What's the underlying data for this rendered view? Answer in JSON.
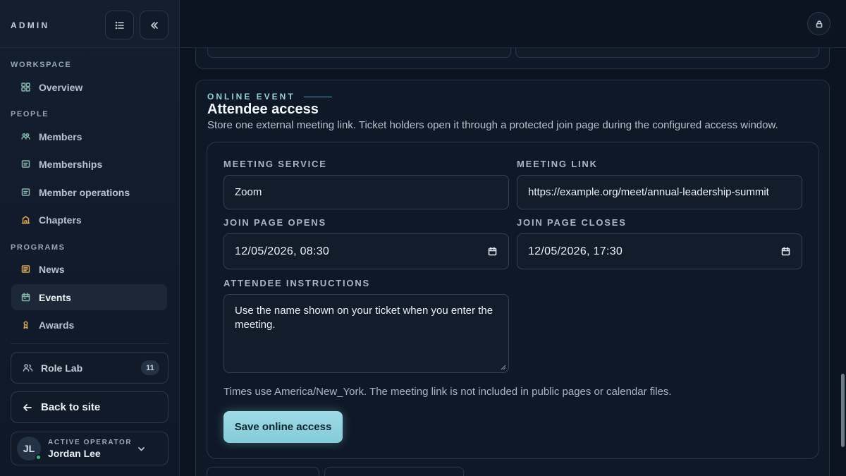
{
  "app": {
    "brand": "ADMIN"
  },
  "sidebar": {
    "sections": [
      {
        "label": "WORKSPACE"
      },
      {
        "label": "PEOPLE"
      },
      {
        "label": "PROGRAMS"
      }
    ],
    "items": [
      {
        "label": "Overview",
        "icon": "layout-icon"
      },
      {
        "label": "Members",
        "icon": "users-icon"
      },
      {
        "label": "Memberships",
        "icon": "card-icon"
      },
      {
        "label": "Member operations",
        "icon": "card-icon"
      },
      {
        "label": "Chapters",
        "icon": "building-icon"
      },
      {
        "label": "News",
        "icon": "newspaper-icon"
      },
      {
        "label": "Events",
        "icon": "calendar-icon",
        "active": true
      },
      {
        "label": "Awards",
        "icon": "trophy-icon"
      }
    ],
    "role_lab": {
      "label": "Role Lab",
      "count": "11"
    },
    "back_to_site": "Back to site",
    "operator": {
      "label": "ACTIVE OPERATOR",
      "name": "Jordan Lee",
      "initials": "JL",
      "status_color": "#3fbf75"
    }
  },
  "online_event": {
    "eyebrow": "ONLINE EVENT",
    "title": "Attendee access",
    "description": "Store one external meeting link. Ticket holders open it through a protected join page during the configured access window.",
    "fields": {
      "meeting_service": {
        "label": "MEETING SERVICE",
        "value": "Zoom"
      },
      "meeting_link": {
        "label": "MEETING LINK",
        "value": "https://example.org/meet/annual-leadership-summit"
      },
      "join_opens": {
        "label": "JOIN PAGE OPENS",
        "value": "12/05/2026, 08:30"
      },
      "join_closes": {
        "label": "JOIN PAGE CLOSES",
        "value": "12/05/2026, 17:30"
      },
      "instructions": {
        "label": "ATTENDEE INSTRUCTIONS",
        "value": "Use the name shown on your ticket when you enter the meeting."
      }
    },
    "note": "Times use America/New_York. The meeting link is not included in public pages or calendar files.",
    "save_label": "Save online access"
  },
  "colors": {
    "accent": "#97cfdb",
    "primary_button": "#9fdbe6",
    "background": "#0b1220",
    "status_online": "#3fbf75"
  }
}
